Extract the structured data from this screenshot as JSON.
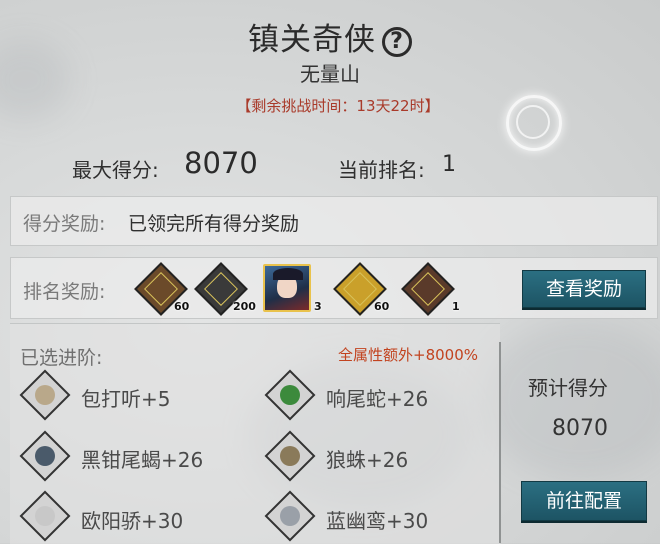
{
  "header": {
    "title": "镇关奇侠",
    "subtitle": "无量山",
    "remaining": "【剩余挑战时间：13天22时】"
  },
  "stats": {
    "max_score_label": "最大得分:",
    "max_score_value": "8070",
    "rank_label": "当前排名:",
    "rank_value": "1"
  },
  "score_reward": {
    "label": "得分奖励:",
    "text": "已领完所有得分奖励"
  },
  "rank_reward": {
    "label": "排名奖励:",
    "items": [
      {
        "icon": "arrows-icon",
        "count": "60",
        "color": "#6b4a2a"
      },
      {
        "icon": "token-icon",
        "count": "200",
        "color": "#3a3a3a"
      },
      {
        "icon": "hero-portrait-icon",
        "count": "3",
        "color": "#2b4a7a"
      },
      {
        "icon": "book-icon",
        "count": "60",
        "color": "#caa02a"
      },
      {
        "icon": "plaque-icon",
        "count": "1",
        "color": "#5a3a2a"
      }
    ],
    "view_button": "查看奖励"
  },
  "selected": {
    "label": "已选进阶:",
    "bonus": "全属性额外+8000%",
    "items": [
      {
        "name": "包打听+5",
        "color": "#b9a88a"
      },
      {
        "name": "响尾蛇+26",
        "color": "#3c8a3c"
      },
      {
        "name": "黑钳尾蝎+26",
        "color": "#4a5a6a"
      },
      {
        "name": "狼蛛+26",
        "color": "#8a7a5a"
      },
      {
        "name": "欧阳骄+30",
        "color": "#c8c8c8"
      },
      {
        "name": "蓝幽鸾+30",
        "color": "#9aa0a8"
      }
    ]
  },
  "estimate": {
    "label": "预计得分",
    "value": "8070",
    "config_button": "前往配置"
  },
  "accent_color": "#1d5464"
}
